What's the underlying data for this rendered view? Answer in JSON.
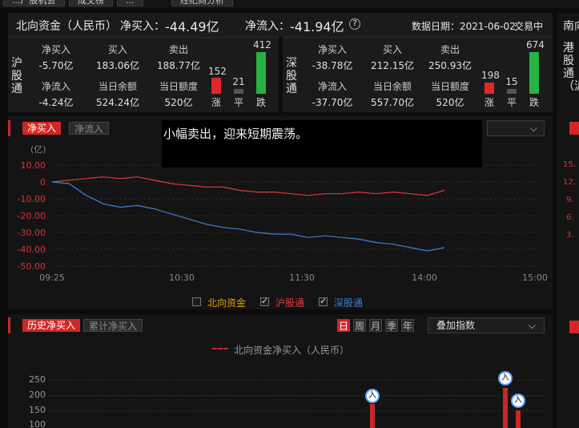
{
  "top_tabs": [
    "...广股机会",
    "成交榜",
    "...",
    "经纪商分析"
  ],
  "header": {
    "title": "北向资金（人民币）",
    "net_buy_label": "净买入：",
    "net_buy_value": "-44.49亿",
    "net_inflow_label": "净流入：",
    "net_inflow_value": "-41.94亿",
    "date_label": "数据日期：2021-06-02",
    "status": "交易中"
  },
  "sh": {
    "label": "沪股通",
    "net_buy_k": "净买入",
    "net_buy_v": "-5.70亿",
    "buy_k": "买入",
    "buy_v": "183.06亿",
    "sell_k": "卖出",
    "sell_v": "188.77亿",
    "net_in_k": "净流入",
    "net_in_v": "-4.24亿",
    "balance_k": "当日余额",
    "balance_v": "524.24亿",
    "quota_k": "当日额度",
    "quota_v": "520亿",
    "up": "152",
    "flat": "21",
    "down": "412",
    "up_l": "涨",
    "flat_l": "平",
    "down_l": "跌"
  },
  "sz": {
    "label": "深股通",
    "net_buy_k": "净买入",
    "net_buy_v": "-38.78亿",
    "buy_k": "买入",
    "buy_v": "212.15亿",
    "sell_k": "卖出",
    "sell_v": "250.93亿",
    "net_in_k": "净流入",
    "net_in_v": "-37.70亿",
    "balance_k": "当日余额",
    "balance_v": "557.70亿",
    "quota_k": "当日额度",
    "quota_v": "520亿",
    "up": "198",
    "flat": "15",
    "down": "674",
    "up_l": "涨",
    "flat_l": "平",
    "down_l": "跌"
  },
  "hk_label": "港股通（沪",
  "hk_title": "南向",
  "chart": {
    "tab_active": "净买入",
    "tab_idle": "净流入",
    "unit": "(亿)",
    "tooltip": "小幅卖出，迎来短期震荡。",
    "legend": {
      "north": "北向资金",
      "sh": "沪股通",
      "sz": "深股通"
    }
  },
  "chart_data": {
    "type": "line",
    "x_ticks": [
      "09:25",
      "10:30",
      "11:30",
      "14:00",
      "15:00"
    ],
    "y_ticks": [
      "10.00",
      "0",
      "-10.00",
      "-20.00",
      "-30.00",
      "-40.00",
      "-50.00"
    ],
    "ylim": [
      -50,
      10
    ],
    "series": [
      {
        "name": "沪股通",
        "color": "#e23b3b",
        "values": [
          0,
          1,
          2,
          3,
          2,
          3,
          1,
          -1,
          -2,
          -3,
          -3,
          -5,
          -6,
          -6,
          -7,
          -8,
          -7,
          -7,
          -6,
          -7,
          -6,
          -7,
          -8,
          -5
        ]
      },
      {
        "name": "深股通",
        "color": "#3f7fd6",
        "values": [
          0,
          -1,
          -8,
          -13,
          -15,
          -14,
          -16,
          -19,
          -22,
          -25,
          -27,
          -28,
          -30,
          -31,
          -31,
          -33,
          -32,
          -33,
          -34,
          -36,
          -37,
          -39,
          -41,
          -39
        ]
      }
    ]
  },
  "hist": {
    "tab_active": "历史净买入",
    "tab_idle": "累计净买入",
    "periods": [
      "日",
      "周",
      "月",
      "季",
      "年"
    ],
    "select": "叠加指数",
    "legend": "北向资金净买入（人民币）",
    "y_ticks": [
      "250",
      "200",
      "150",
      "100"
    ],
    "marker": "入"
  }
}
